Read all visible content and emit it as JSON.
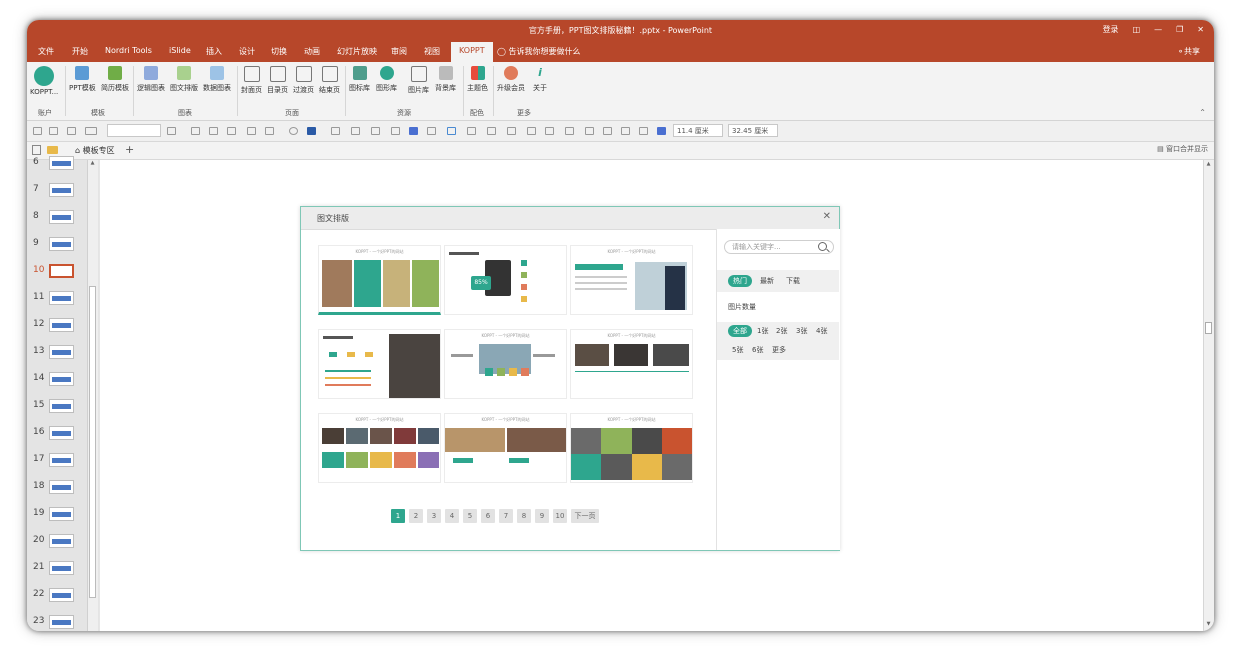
{
  "titlebar": {
    "title": "官方手册，PPT图文排版秘籍！.pptx  -  PowerPoint",
    "login": "登录"
  },
  "menubar": {
    "tabs": [
      "文件",
      "开始",
      "Nordri Tools",
      "iSlide",
      "插入",
      "设计",
      "切换",
      "动画",
      "幻灯片放映",
      "审阅",
      "视图"
    ],
    "active_tab": "KOPPT",
    "tell_me": "告诉我你想要做什么",
    "share": "共享"
  },
  "ribbon": {
    "buttons": [
      "KOPPT...",
      "PPT模板",
      "简历模板",
      "逻辑图表",
      "图文排版",
      "数据图表",
      "封面页",
      "目录页",
      "过渡页",
      "结束页",
      "图标库",
      "图形库",
      "图片库",
      "背景库",
      "主题色",
      "升级会员",
      "关于"
    ],
    "groups": [
      "账户",
      "模板",
      "图表",
      "页面",
      "资源",
      "配色",
      "更多"
    ]
  },
  "toolrow": {
    "width": "11.4 厘米",
    "height": "32.45 厘米"
  },
  "tabbar": {
    "template_tab": "模板专区",
    "merge": "窗口合并显示"
  },
  "slides": {
    "numbers": [
      "6",
      "7",
      "8",
      "9",
      "10",
      "11",
      "12",
      "13",
      "14",
      "15",
      "16",
      "17",
      "18",
      "19",
      "20",
      "21",
      "22",
      "23"
    ],
    "active": "10"
  },
  "dialog": {
    "title": "图文排版",
    "captions": [
      "KOPPT - 一个好PPT的网站",
      "KOPPT - 一个好PPT的网站",
      "KOPPT - 一个好PPT的网站",
      "KOPPT - 一个好PPT的网站",
      "KOPPT - 一个好PPT的网站",
      "KOPPT - 一个好PPT的网站",
      "KOPPT - 一个好PPT的网站",
      "KOPPT - 一个好PPT的网站",
      "KOPPT - 一个好PPT的网站"
    ],
    "percent": "85%",
    "pages": [
      "1",
      "2",
      "3",
      "4",
      "5",
      "6",
      "7",
      "8",
      "9",
      "10"
    ],
    "next_page": "下一页",
    "search_placeholder": "请输入关键字...",
    "sort_tabs": [
      "热门",
      "最新",
      "下载"
    ],
    "count_label": "图片数量",
    "counts": [
      "全部",
      "1张",
      "2张",
      "3张",
      "4张",
      "5张",
      "6张",
      "更多"
    ]
  },
  "colors": {
    "brand": "#b7472a",
    "accent": "#2ea68e"
  }
}
